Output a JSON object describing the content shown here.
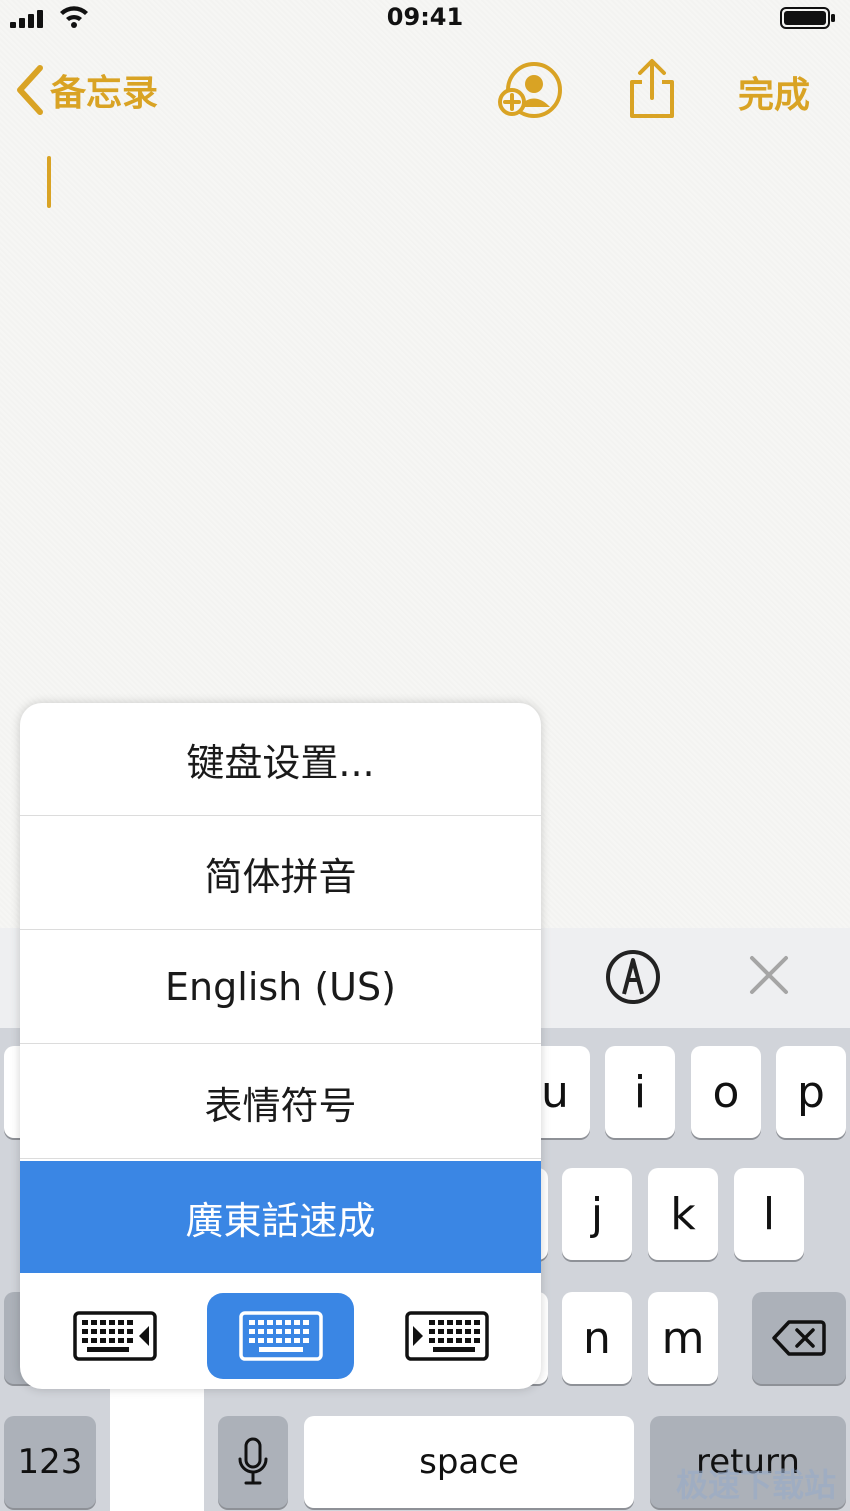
{
  "status_bar": {
    "time": "09:41"
  },
  "nav": {
    "back_label": "备忘录",
    "done_label": "完成"
  },
  "menu": {
    "items": [
      {
        "label": "键盘设置..."
      },
      {
        "label": "简体拼音"
      },
      {
        "label": "English (US)"
      },
      {
        "label": "表情符号"
      },
      {
        "label": "廣東話速成",
        "selected": true
      }
    ],
    "keyboard_modes": [
      "left",
      "center",
      "right"
    ],
    "active_mode": "center"
  },
  "keyboard": {
    "row1": [
      "u",
      "i",
      "o",
      "p"
    ],
    "row2": [
      "j",
      "k",
      "l"
    ],
    "row3": [
      "n",
      "m"
    ],
    "numbers_label": "123",
    "space_label": "space",
    "return_label": "return"
  },
  "watermark": "极速下载站",
  "colors": {
    "accent": "#d9a324",
    "selection": "#3a86e4",
    "keyboard_bg": "#d1d4da"
  }
}
